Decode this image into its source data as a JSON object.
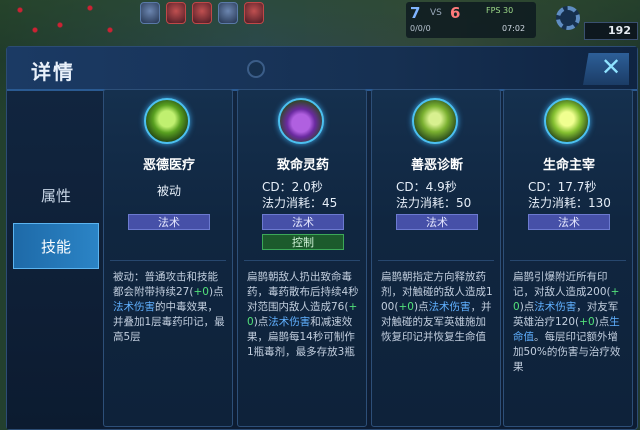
{
  "hud": {
    "score_blue": "7",
    "score_vs": "VS",
    "score_red": "6",
    "fps": "FPS 30",
    "kda": "0/0/0",
    "time": "07:02",
    "gold": "192"
  },
  "dialog": {
    "title": "详情",
    "close_icon": "close-icon"
  },
  "sidebar": {
    "tabs": [
      {
        "label": "属性",
        "active": false
      },
      {
        "label": "技能",
        "active": true
      }
    ]
  },
  "skills": [
    {
      "icon": "healing-staff-icon",
      "name": "恶德医疗",
      "type_text": "被动",
      "tags": [
        "法术"
      ],
      "desc_parts": [
        {
          "t": "被动：普通攻击和技能都会附带持续27(",
          "c": ""
        },
        {
          "t": "+0",
          "c": "green"
        },
        {
          "t": ")点",
          "c": ""
        },
        {
          "t": "法术伤害",
          "c": "blue"
        },
        {
          "t": "的中毒效果，并叠加1层毒药印记，最高5层",
          "c": ""
        }
      ]
    },
    {
      "icon": "poison-potion-icon",
      "name": "致命灵药",
      "cd": "CD：2.0秒",
      "cost": "法力消耗：45",
      "tags": [
        "法术",
        "控制"
      ],
      "desc_parts": [
        {
          "t": "扁鹊朝敌人扔出致命毒药，毒药散布后持续4秒对范围内敌人造成76(",
          "c": ""
        },
        {
          "t": "+0",
          "c": "green"
        },
        {
          "t": ")点",
          "c": ""
        },
        {
          "t": "法术伤害",
          "c": "blue"
        },
        {
          "t": "和减速效果，扁鹊每14秒可制作1瓶毒剂，最多存放3瓶",
          "c": ""
        }
      ]
    },
    {
      "icon": "good-evil-diagnosis-icon",
      "name": "善恶诊断",
      "cd": "CD：4.9秒",
      "cost": "法力消耗：50",
      "tags": [
        "法术"
      ],
      "desc_parts": [
        {
          "t": "扁鹊朝指定方向释放药剂，对触碰的敌人造成100(",
          "c": ""
        },
        {
          "t": "+0",
          "c": "green"
        },
        {
          "t": ")点",
          "c": ""
        },
        {
          "t": "法术伤害",
          "c": "blue"
        },
        {
          "t": "，并对触碰的友军英雄施加恢复印记并恢复生命值",
          "c": ""
        }
      ]
    },
    {
      "icon": "life-master-icon",
      "name": "生命主宰",
      "cd": "CD：17.7秒",
      "cost": "法力消耗：130",
      "tags": [
        "法术"
      ],
      "desc_parts": [
        {
          "t": "扁鹊引爆附近所有印记，对敌人造成200(",
          "c": ""
        },
        {
          "t": "+0",
          "c": "green"
        },
        {
          "t": ")点",
          "c": ""
        },
        {
          "t": "法术伤害",
          "c": "blue"
        },
        {
          "t": "，对友军英雄治疗120(",
          "c": ""
        },
        {
          "t": "+0",
          "c": "green"
        },
        {
          "t": ")点",
          "c": ""
        },
        {
          "t": "生命值",
          "c": "blue"
        },
        {
          "t": "。每层印记额外增加50%的伤害与治疗效果",
          "c": ""
        }
      ]
    }
  ]
}
